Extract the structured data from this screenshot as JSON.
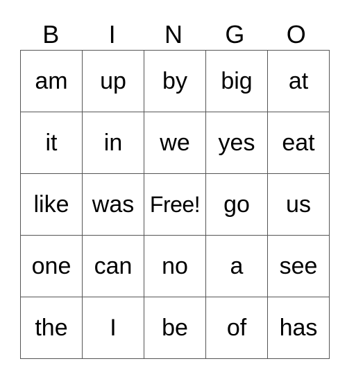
{
  "header": [
    "B",
    "I",
    "N",
    "G",
    "O"
  ],
  "rows": [
    [
      "am",
      "up",
      "by",
      "big",
      "at"
    ],
    [
      "it",
      "in",
      "we",
      "yes",
      "eat"
    ],
    [
      "like",
      "was",
      "Free!",
      "go",
      "us"
    ],
    [
      "one",
      "can",
      "no",
      "a",
      "see"
    ],
    [
      "the",
      "I",
      "be",
      "of",
      "has"
    ]
  ]
}
